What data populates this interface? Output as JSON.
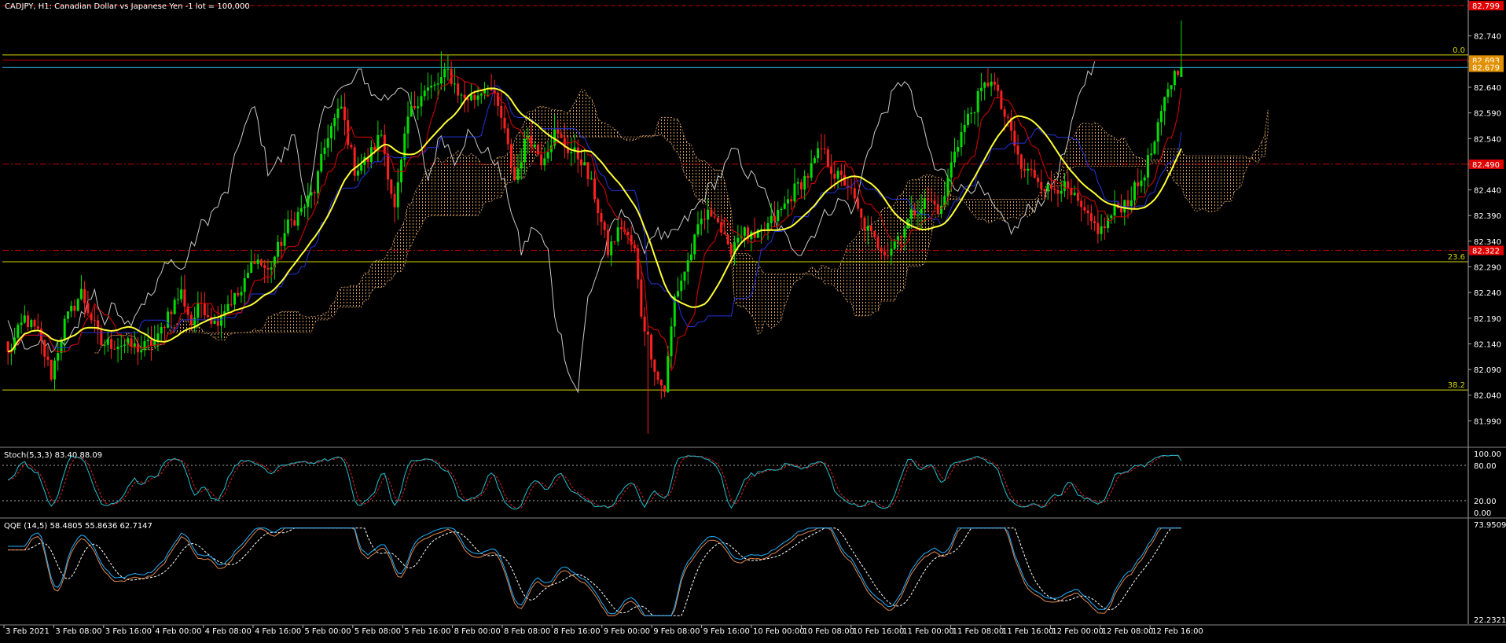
{
  "header": {
    "symbol_title": "CADJPY, H1:  Canadian Dollar vs Japanese Yen -1 lot = 100,000"
  },
  "colors": {
    "background": "#000000",
    "bull_candle": "#00e000",
    "bear_candle": "#ff2020",
    "ma_yellow": "#ffff33",
    "tenkan_red": "#e00000",
    "kijun_blue": "#2233dd",
    "chikou_white": "#c8c8c8",
    "cloud_orange": "#d9a060",
    "fibo_yellow": "#d4d400",
    "ask_line_cyan": "#33bbff",
    "stoch_main": "#20c0d0",
    "stoch_signal": "#e02020",
    "qqe_line1": "#20b0ff",
    "qqe_line2": "#e08850",
    "qqe_line3": "#ffffff"
  },
  "price_axis": {
    "ticks": [
      "82.740",
      "82.690",
      "82.640",
      "82.590",
      "82.540",
      "82.490",
      "82.440",
      "82.390",
      "82.340",
      "82.290",
      "82.240",
      "82.190",
      "82.140",
      "82.090",
      "82.040",
      "81.990"
    ],
    "badges": [
      {
        "label": "82.799",
        "color": "#e00000",
        "value": 82.799
      },
      {
        "label": "82.693",
        "color": "#e09000",
        "value": 82.693
      },
      {
        "label": "82.679",
        "color": "#e09000",
        "value": 82.679
      },
      {
        "label": "82.490",
        "color": "#e00000",
        "value": 82.49
      },
      {
        "label": "82.322",
        "color": "#e00000",
        "value": 82.322
      }
    ]
  },
  "fibo_levels": [
    {
      "label": "0.0",
      "value": 82.703
    },
    {
      "label": "23.6",
      "value": 82.3
    },
    {
      "label": "38.2",
      "value": 82.05
    }
  ],
  "time_axis": {
    "labels": [
      "3 Feb 2021",
      "3 Feb 08:00",
      "3 Feb 16:00",
      "4 Feb 00:00",
      "4 Feb 08:00",
      "4 Feb 16:00",
      "5 Feb 00:00",
      "5 Feb 08:00",
      "5 Feb 16:00",
      "8 Feb 00:00",
      "8 Feb 08:00",
      "8 Feb 16:00",
      "9 Feb 00:00",
      "9 Feb 08:00",
      "9 Feb 16:00",
      "10 Feb 00:00",
      "10 Feb 08:00",
      "10 Feb 16:00",
      "11 Feb 00:00",
      "11 Feb 08:00",
      "11 Feb 16:00",
      "12 Feb 00:00",
      "12 Feb 08:00",
      "12 Feb 16:00"
    ]
  },
  "stoch_panel": {
    "title": "Stoch(5,3,3) 83.40 88.09",
    "ticks": [
      "100.00",
      "80.00",
      "20.00",
      "0.00"
    ]
  },
  "qqe_panel": {
    "title": "QQE (14,5) 58.4805 55.8636 62.7147",
    "ticks": [
      "73.9509",
      "22.2321"
    ]
  },
  "chart_data": {
    "type": "candlestick",
    "title": "CADJPY, H1:  Canadian Dollar vs Japanese Yen -1 lot = 100,000",
    "ylim": [
      81.94,
      82.81
    ],
    "candle_count": 240,
    "close_keypoints": [
      [
        0,
        82.12
      ],
      [
        5,
        82.19
      ],
      [
        9,
        82.16
      ],
      [
        13,
        82.08
      ],
      [
        17,
        82.18
      ],
      [
        22,
        82.24
      ],
      [
        28,
        82.14
      ],
      [
        34,
        82.14
      ],
      [
        40,
        82.13
      ],
      [
        45,
        82.15
      ],
      [
        48,
        82.2
      ],
      [
        52,
        82.24
      ],
      [
        55,
        82.18
      ],
      [
        58,
        82.22
      ],
      [
        62,
        82.18
      ],
      [
        66,
        82.22
      ],
      [
        70,
        82.24
      ],
      [
        74,
        82.31
      ],
      [
        78,
        82.28
      ],
      [
        84,
        82.37
      ],
      [
        88,
        82.4
      ],
      [
        92,
        82.44
      ],
      [
        96,
        82.55
      ],
      [
        100,
        82.6
      ],
      [
        104,
        82.48
      ],
      [
        108,
        82.5
      ],
      [
        112,
        82.55
      ],
      [
        116,
        82.4
      ],
      [
        120,
        82.58
      ],
      [
        124,
        82.63
      ],
      [
        128,
        82.64
      ],
      [
        132,
        82.67
      ],
      [
        136,
        82.62
      ],
      [
        140,
        82.62
      ],
      [
        144,
        82.65
      ],
      [
        148,
        82.58
      ],
      [
        152,
        82.46
      ],
      [
        156,
        82.55
      ],
      [
        160,
        82.5
      ],
      [
        164,
        82.55
      ],
      [
        168,
        82.52
      ],
      [
        172,
        82.5
      ],
      [
        176,
        82.43
      ],
      [
        180,
        82.32
      ],
      [
        184,
        82.37
      ],
      [
        188,
        82.32
      ],
      [
        190,
        82.2
      ],
      [
        192,
        82.15
      ],
      [
        195,
        82.07
      ],
      [
        197,
        82.05
      ],
      [
        200,
        82.23
      ],
      [
        204,
        82.3
      ],
      [
        208,
        82.38
      ],
      [
        212,
        82.4
      ],
      [
        216,
        82.32
      ],
      [
        220,
        82.36
      ],
      [
        224,
        82.34
      ],
      [
        228,
        82.37
      ],
      [
        232,
        82.4
      ],
      [
        236,
        82.44
      ],
      [
        240,
        82.47
      ],
      [
        244,
        82.52
      ],
      [
        248,
        82.47
      ],
      [
        252,
        82.45
      ],
      [
        256,
        82.38
      ],
      [
        260,
        82.34
      ],
      [
        264,
        82.32
      ],
      [
        268,
        82.36
      ],
      [
        272,
        82.4
      ],
      [
        276,
        82.42
      ],
      [
        280,
        82.4
      ],
      [
        284,
        82.52
      ],
      [
        288,
        82.58
      ],
      [
        292,
        82.63
      ],
      [
        295,
        82.66
      ],
      [
        298,
        82.6
      ],
      [
        301,
        82.55
      ],
      [
        304,
        82.48
      ],
      [
        308,
        82.47
      ],
      [
        312,
        82.44
      ],
      [
        316,
        82.45
      ],
      [
        320,
        82.42
      ],
      [
        324,
        82.38
      ],
      [
        328,
        82.36
      ],
      [
        332,
        82.4
      ],
      [
        336,
        82.42
      ],
      [
        340,
        82.46
      ],
      [
        344,
        82.53
      ],
      [
        348,
        82.64
      ],
      [
        352,
        82.69
      ]
    ],
    "last_bar": {
      "open": 82.66,
      "high": 82.77,
      "low": 82.66,
      "close": 82.679
    },
    "indicators": [
      "Moving Average (yellow)",
      "Ichimoku Tenkan (red)",
      "Ichimoku Kijun (blue)",
      "Chikou Span (white)",
      "Kumo cloud (orange dotted)",
      "Fibonacci retracement (yellow)",
      "Stochastic 5,3,3",
      "QQE 14,5"
    ]
  }
}
